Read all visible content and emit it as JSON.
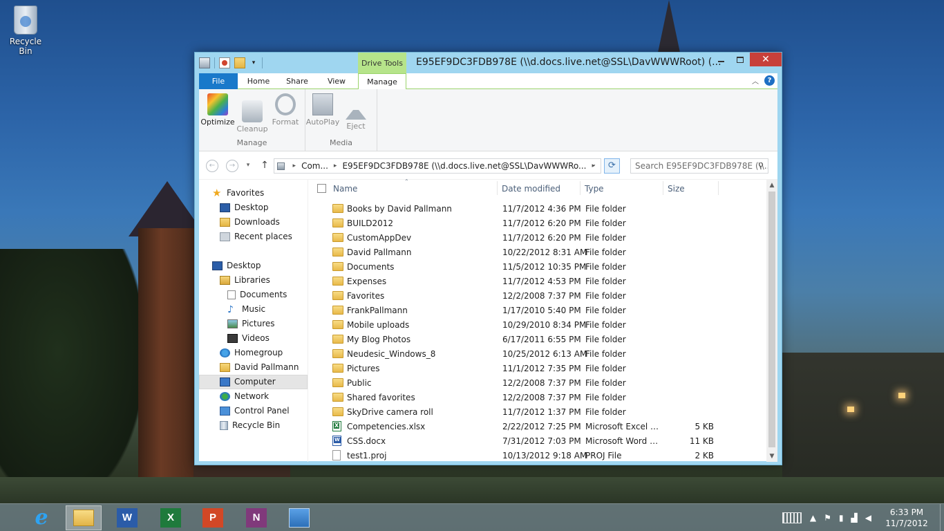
{
  "desktop": {
    "icons": [
      {
        "label": "Recycle Bin",
        "icon": "recycle-bin-icon"
      }
    ]
  },
  "window": {
    "title": "E95EF9DC3FDB978E (\\\\d.docs.live.net@SSL\\DavWWWRoot) (...",
    "context_tab_group": "Drive Tools",
    "close_glyph": "✕",
    "tabs": [
      "File",
      "Home",
      "Share",
      "View",
      "Manage"
    ],
    "active_tab": "Manage",
    "ribbon": {
      "groups": [
        {
          "label": "Manage",
          "buttons": [
            {
              "label": "Optimize",
              "icon": "optimize-icon",
              "enabled": true
            },
            {
              "label": "Cleanup",
              "icon": "cleanup-icon",
              "enabled": false
            },
            {
              "label": "Format",
              "icon": "format-icon",
              "enabled": false
            }
          ]
        },
        {
          "label": "Media",
          "buttons": [
            {
              "label": "AutoPlay",
              "icon": "autoplay-icon",
              "enabled": false
            },
            {
              "label": "Eject",
              "icon": "eject-icon",
              "enabled": false
            }
          ]
        }
      ]
    },
    "address": {
      "segments": [
        "Com...",
        "E95EF9DC3FDB978E (\\\\d.docs.live.net@SSL\\DavWWWRo..."
      ],
      "search_placeholder": "Search E95EF9DC3FDB978E (\\\\..."
    },
    "nav_pane": {
      "items": [
        {
          "label": "Favorites",
          "icon": "star-icon"
        },
        {
          "label": "Desktop",
          "icon": "desktop-icon"
        },
        {
          "label": "Downloads",
          "icon": "downloads-icon"
        },
        {
          "label": "Recent places",
          "icon": "recent-places-icon"
        },
        {
          "label": "Desktop",
          "icon": "desktop-icon"
        },
        {
          "label": "Libraries",
          "icon": "libraries-icon"
        },
        {
          "label": "Documents",
          "icon": "documents-icon"
        },
        {
          "label": "Music",
          "icon": "music-icon"
        },
        {
          "label": "Pictures",
          "icon": "pictures-icon"
        },
        {
          "label": "Videos",
          "icon": "videos-icon"
        },
        {
          "label": "Homegroup",
          "icon": "homegroup-icon"
        },
        {
          "label": "David Pallmann",
          "icon": "user-folder-icon"
        },
        {
          "label": "Computer",
          "icon": "computer-icon",
          "selected": true
        },
        {
          "label": "Network",
          "icon": "network-icon"
        },
        {
          "label": "Control Panel",
          "icon": "control-panel-icon"
        },
        {
          "label": "Recycle Bin",
          "icon": "recycle-bin-icon"
        }
      ]
    },
    "columns": [
      "Name",
      "Date modified",
      "Type",
      "Size"
    ],
    "files": [
      {
        "name": "Books by David Pallmann",
        "date": "11/7/2012 4:36 PM",
        "type": "File folder",
        "size": "",
        "icon": "folder-icon"
      },
      {
        "name": "BUILD2012",
        "date": "11/7/2012 6:20 PM",
        "type": "File folder",
        "size": "",
        "icon": "folder-icon"
      },
      {
        "name": "CustomAppDev",
        "date": "11/7/2012 6:20 PM",
        "type": "File folder",
        "size": "",
        "icon": "folder-icon"
      },
      {
        "name": "David Pallmann",
        "date": "10/22/2012 8:31 AM",
        "type": "File folder",
        "size": "",
        "icon": "folder-icon"
      },
      {
        "name": "Documents",
        "date": "11/5/2012 10:35 PM",
        "type": "File folder",
        "size": "",
        "icon": "folder-icon"
      },
      {
        "name": "Expenses",
        "date": "11/7/2012 4:53 PM",
        "type": "File folder",
        "size": "",
        "icon": "folder-icon"
      },
      {
        "name": "Favorites",
        "date": "12/2/2008 7:37 PM",
        "type": "File folder",
        "size": "",
        "icon": "folder-icon"
      },
      {
        "name": "FrankPallmann",
        "date": "1/17/2010 5:40 PM",
        "type": "File folder",
        "size": "",
        "icon": "folder-icon"
      },
      {
        "name": "Mobile uploads",
        "date": "10/29/2010 8:34 PM",
        "type": "File folder",
        "size": "",
        "icon": "folder-icon"
      },
      {
        "name": "My Blog Photos",
        "date": "6/17/2011 6:55 PM",
        "type": "File folder",
        "size": "",
        "icon": "folder-icon"
      },
      {
        "name": "Neudesic_Windows_8",
        "date": "10/25/2012 6:13 AM",
        "type": "File folder",
        "size": "",
        "icon": "folder-icon"
      },
      {
        "name": "Pictures",
        "date": "11/1/2012 7:35 PM",
        "type": "File folder",
        "size": "",
        "icon": "folder-icon"
      },
      {
        "name": "Public",
        "date": "12/2/2008 7:37 PM",
        "type": "File folder",
        "size": "",
        "icon": "folder-icon"
      },
      {
        "name": "Shared favorites",
        "date": "12/2/2008 7:37 PM",
        "type": "File folder",
        "size": "",
        "icon": "folder-icon"
      },
      {
        "name": "SkyDrive camera roll",
        "date": "11/7/2012 1:37 PM",
        "type": "File folder",
        "size": "",
        "icon": "folder-icon"
      },
      {
        "name": "Competencies.xlsx",
        "date": "2/22/2012 7:25 PM",
        "type": "Microsoft Excel W...",
        "size": "5 KB",
        "icon": "excel-file-icon"
      },
      {
        "name": "CSS.docx",
        "date": "7/31/2012 7:03 PM",
        "type": "Microsoft Word D...",
        "size": "11 KB",
        "icon": "word-file-icon"
      },
      {
        "name": "test1.proj",
        "date": "10/13/2012 9:18 AM",
        "type": "PROJ File",
        "size": "2 KB",
        "icon": "file-icon"
      }
    ]
  },
  "taskbar": {
    "apps": [
      {
        "name": "Internet Explorer",
        "icon": "internet-explorer-icon",
        "glyph": "e"
      },
      {
        "name": "File Explorer",
        "icon": "file-explorer-icon",
        "glyph": "",
        "active": true
      },
      {
        "name": "Word",
        "icon": "word-icon",
        "glyph": "W"
      },
      {
        "name": "Excel",
        "icon": "excel-icon",
        "glyph": "X"
      },
      {
        "name": "PowerPoint",
        "icon": "powerpoint-icon",
        "glyph": "P"
      },
      {
        "name": "OneNote",
        "icon": "onenote-icon",
        "glyph": "N"
      },
      {
        "name": "Remote Desktop",
        "icon": "remote-desktop-icon",
        "glyph": ""
      }
    ],
    "tray_icons": [
      {
        "icon": "show-hidden-icons-icon",
        "glyph": "▲"
      },
      {
        "icon": "action-center-flag-icon",
        "glyph": "⚑"
      },
      {
        "icon": "power-icon",
        "glyph": "▮"
      },
      {
        "icon": "network-signal-icon",
        "glyph": "▟"
      },
      {
        "icon": "volume-icon",
        "glyph": "◀"
      }
    ],
    "clock": {
      "time": "6:33 PM",
      "date": "11/7/2012"
    }
  }
}
